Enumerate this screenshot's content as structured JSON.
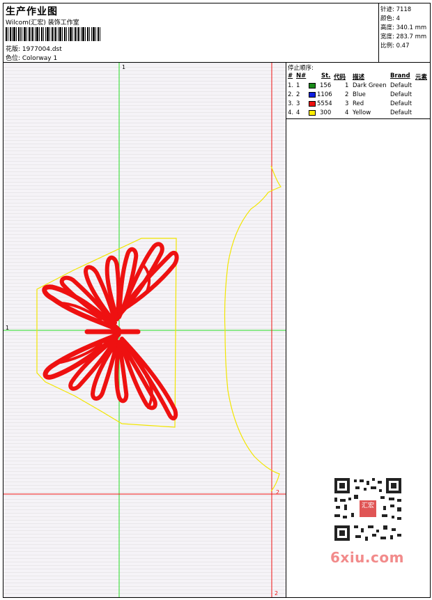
{
  "header": {
    "title": "生产作业图",
    "subtitle": "Wilcom(汇宏) 装饰工作室",
    "design_label": "花版: 1977004.dst",
    "colorway_label": "色位: Colorway 1"
  },
  "stats": {
    "stitches": "针迹: 7118",
    "colors": "颜色: 4",
    "height": "高度: 340.1 mm",
    "width": "宽度: 283.7 mm",
    "scale": "比例: 0.47"
  },
  "stop_sequence": {
    "title": "停止顺序:",
    "columns": [
      "#",
      "N#",
      "St.",
      "代码",
      "描述",
      "Brand",
      "元素"
    ],
    "rows": [
      {
        "num": "1.",
        "n": "1",
        "color": "#1a8c1a",
        "st": "156",
        "code": "1",
        "desc": "Dark Green",
        "brand": "Default"
      },
      {
        "num": "2.",
        "n": "2",
        "color": "#1020e0",
        "st": "1106",
        "code": "2",
        "desc": "Blue",
        "brand": "Default"
      },
      {
        "num": "3.",
        "n": "3",
        "color": "#ee1111",
        "st": "5554",
        "code": "3",
        "desc": "Red",
        "brand": "Default"
      },
      {
        "num": "4.",
        "n": "4",
        "color": "#ffee00",
        "st": "300",
        "code": "4",
        "desc": "Yellow",
        "brand": "Default"
      }
    ]
  },
  "markers": {
    "green_top": "1",
    "green_left": "1",
    "red_right": "2",
    "red_bottom": "2"
  },
  "watermark": {
    "text": "6xiu.com",
    "seal": "汇宏"
  },
  "colors": {
    "guide_green": "#22dd22",
    "guide_red": "#ee1111",
    "outline_yellow": "#f2e600",
    "design_red": "#ee1111"
  }
}
